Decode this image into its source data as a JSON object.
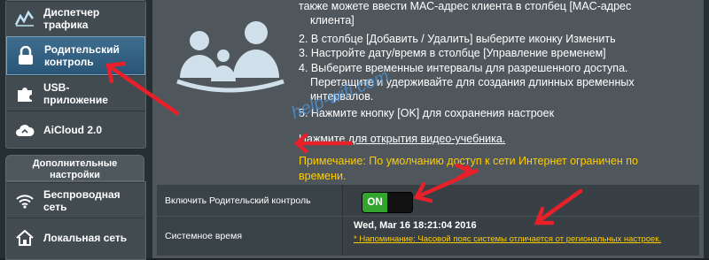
{
  "sidebar": {
    "items": [
      {
        "label": "Диспетчер трафика",
        "icon": "traffic-graph-icon"
      },
      {
        "label": "Родительский контроль",
        "icon": "lock-icon",
        "active": true
      },
      {
        "label": "USB-приложение",
        "icon": "puzzle-icon"
      },
      {
        "label": "AiCloud 2.0",
        "icon": "cloud-icon"
      }
    ],
    "section_title": "Дополнительные настройки",
    "section_items": [
      {
        "label": "Беспроводная сеть",
        "icon": "wifi-icon"
      },
      {
        "label": "Локальная сеть",
        "icon": "home-icon"
      }
    ]
  },
  "instructions": {
    "line1": "также можете ввести МАС-адрес клиента в столбец [MAC-адрес",
    "line1b": "клиента]",
    "line2": "2. В столбце [Добавить / Удалить] выберите иконку Изменить",
    "line3": "3. Настройте дату/время в столбце [Управление временем]",
    "line4": "4. Выберите временные интервалы для разрешенного доступа.",
    "line4b": "Перетащите и удерживайте для создания длинных временных",
    "line4c": "интервалов.",
    "line5": "5. Нажмите кнопку [OK] для сохранения настроек",
    "video_link": "Нажмите для открытия видео-учебника.",
    "note_line1": "Примечание: По умолчанию доступ к сети Интернет ограничен по",
    "note_line2": "времени."
  },
  "watermark": "help-wifi.com",
  "settings": {
    "enable_label": "Включить Родительский контроль",
    "toggle_value": "ON",
    "system_time_label": "Системное время",
    "system_time": "Wed, Mar 16 18:21:04 2016",
    "tz_warning": "* Напоминание: Часовой пояс системы отличается от региональных настроек."
  },
  "colors": {
    "accent_arrow": "#e8202a",
    "toggle_on": "#33a52e",
    "note": "#ffcc00"
  }
}
